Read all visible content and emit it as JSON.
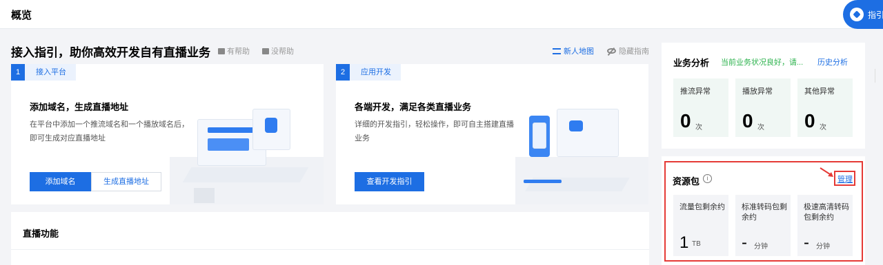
{
  "topbar": {
    "title": "概览",
    "guide_button": "指引"
  },
  "guide": {
    "title": "接入指引，助你高效开发自有直播业务",
    "helpful": "有帮助",
    "not_helpful": "没帮助",
    "new_map": "新人地图",
    "hide": "隐藏指南",
    "steps": [
      {
        "num": "1",
        "name": "接入平台",
        "title": "添加域名，生成直播地址",
        "desc": "在平台中添加一个推流域名和一个播放域名后，即可生成对应直播地址",
        "primary": "添加域名",
        "secondary": "生成直播地址"
      },
      {
        "num": "2",
        "name": "应用开发",
        "title": "各端开发，满足各类直播业务",
        "desc": "详细的开发指引，轻松操作，即可自主搭建直播业务",
        "primary": "查看开发指引"
      }
    ]
  },
  "features": {
    "title": "直播功能"
  },
  "business": {
    "title": "业务分析",
    "status": "当前业务状况良好，请...",
    "history": "历史分析",
    "stats": [
      {
        "label": "推流异常",
        "value": "0",
        "unit": "次"
      },
      {
        "label": "播放异常",
        "value": "0",
        "unit": "次"
      },
      {
        "label": "其他异常",
        "value": "0",
        "unit": "次"
      }
    ]
  },
  "resources": {
    "title": "资源包",
    "info": "i",
    "manage": "管理",
    "items": [
      {
        "label": "流量包剩余约",
        "value": "1",
        "unit": "TB"
      },
      {
        "label": "标准转码包剩余约",
        "value": "-",
        "unit": "分钟"
      },
      {
        "label": "极速高清转码包剩余约",
        "value": "-",
        "unit": "分钟"
      }
    ]
  },
  "colors": {
    "primary": "#1d6ee3",
    "success": "#2bb24c",
    "highlight": "#e53935"
  }
}
